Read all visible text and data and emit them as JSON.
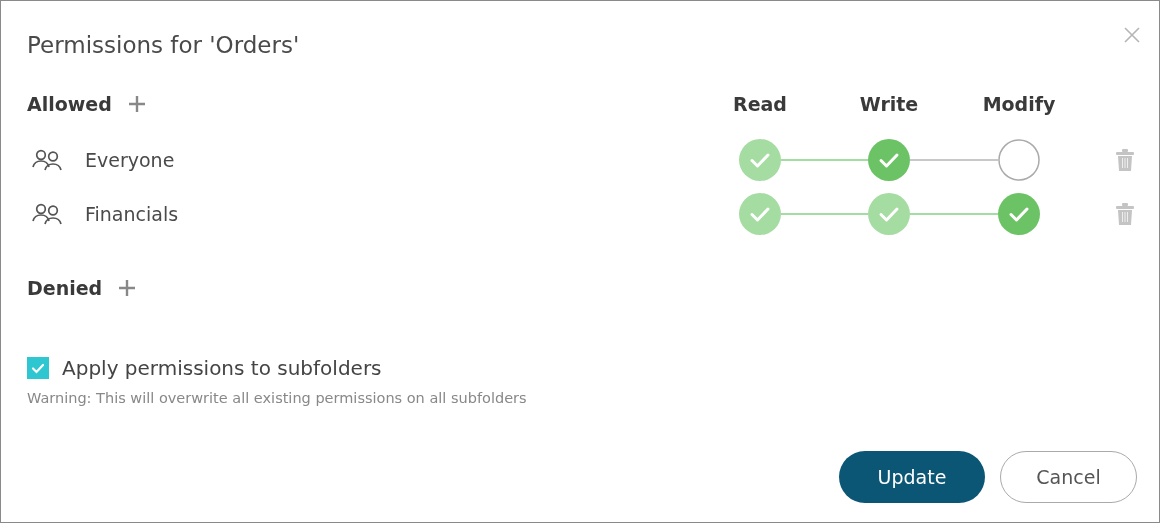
{
  "dialog": {
    "title": "Permissions for 'Orders'"
  },
  "allowed": {
    "label": "Allowed",
    "columns": [
      "Read",
      "Write",
      "Modify"
    ],
    "entries": [
      {
        "name": "Everyone",
        "permissions": [
          {
            "kind": "implied"
          },
          {
            "kind": "granted"
          },
          {
            "kind": "none"
          }
        ]
      },
      {
        "name": "Financials",
        "permissions": [
          {
            "kind": "implied"
          },
          {
            "kind": "implied"
          },
          {
            "kind": "granted"
          }
        ]
      }
    ]
  },
  "denied": {
    "label": "Denied"
  },
  "apply_to_subfolders": {
    "label": "Apply permissions to subfolders",
    "checked": true
  },
  "warning": "Warning: This will overwrite all existing permissions on all subfolders",
  "buttons": [
    {
      "label": "Update",
      "kind": "primary"
    },
    {
      "label": "Cancel",
      "kind": "secondary"
    }
  ]
}
